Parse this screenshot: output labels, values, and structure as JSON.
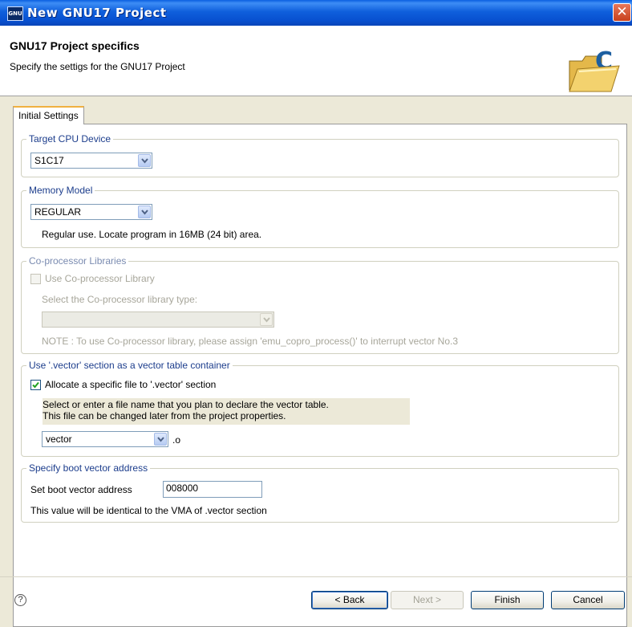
{
  "window": {
    "title": "New GNU17 Project",
    "icon_label": "GNU"
  },
  "header": {
    "title": "GNU17 Project specifics",
    "description": "Specify the settigs for the GNU17 Project"
  },
  "tab": {
    "label": "Initial Settings"
  },
  "target_cpu": {
    "legend": "Target CPU Device",
    "value": "S1C17"
  },
  "memory_model": {
    "legend": "Memory Model",
    "value": "REGULAR",
    "description": "Regular use. Locate program in 16MB (24 bit) area."
  },
  "coprocessor": {
    "legend": "Co-processor Libraries",
    "checkbox_label": "Use Co-processor Library",
    "checked": false,
    "type_label": "Select the Co-processor library type:",
    "value": "",
    "note": "NOTE : To use Co-processor library, please assign 'emu_copro_process()' to interrupt vector No.3"
  },
  "vector_section": {
    "legend": "Use '.vector' section as a vector table container",
    "checkbox_label": "Allocate a specific file to '.vector' section",
    "checked": true,
    "hint_line1": "Select or enter a file name that you plan to declare the vector table.",
    "hint_line2": "This file can be changed later from the project properties.",
    "file_value": "vector",
    "suffix": ".o"
  },
  "boot_vector": {
    "legend": "Specify boot vector address",
    "label": "Set boot vector address",
    "value": "008000",
    "note": "This value will be identical to the VMA of .vector section"
  },
  "buttons": {
    "help": "?",
    "back": "< Back",
    "next": "Next >",
    "finish": "Finish",
    "cancel": "Cancel"
  },
  "colors": {
    "titlebar": "#0a5fe0",
    "legend_text": "#1c3d8c",
    "tab_highlight": "#f0b040"
  }
}
